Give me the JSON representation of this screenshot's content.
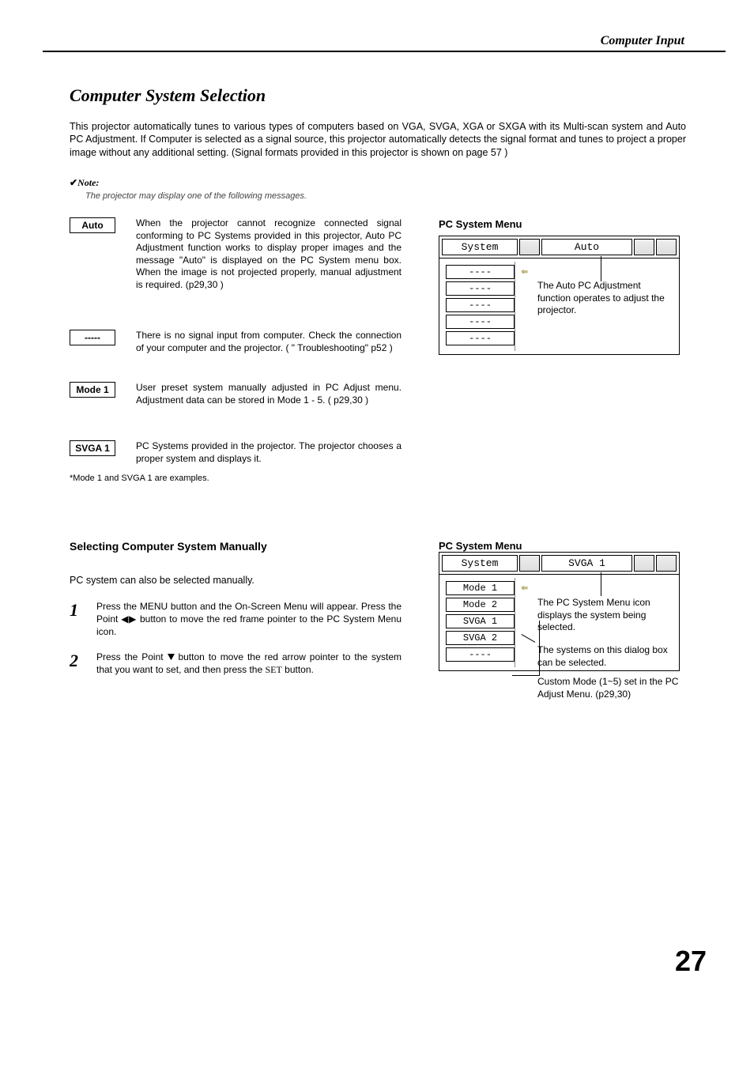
{
  "header": {
    "section": "Computer Input"
  },
  "title": "Computer System Selection",
  "intro": "This projector automatically tunes to various types of computers based on VGA, SVGA, XGA or SXGA with its Multi-scan system and Auto PC Adjustment.  If Computer is selected as a signal source, this projector automatically detects the signal format and tunes to project a proper image without any additional setting.  (Signal formats provided in this projector is shown on page 57 )",
  "note": {
    "label": "Note:",
    "text": "The projector may display one of the following messages."
  },
  "boxes": {
    "auto": {
      "label": "Auto",
      "text": "When the projector cannot recognize connected signal conforming to PC Systems provided in this projector, Auto PC Adjustment function works to display proper images and the message \"Auto\" is displayed on the PC System menu box.  When the image is not projected properly, manual adjustment is required.  (p29,30 )"
    },
    "dash": {
      "label": "-----",
      "text": "There is no signal input from computer.  Check the connection of your computer and the projector.   ( \" Troubleshooting\" p52 )"
    },
    "mode1": {
      "label": "Mode 1",
      "text": "User preset system manually adjusted in PC Adjust menu.  Adjustment data can be stored in Mode 1 - 5. ( p29,30 )"
    },
    "svga1": {
      "label": "SVGA 1",
      "text": "PC Systems provided in the projector.  The projector chooses a proper system and displays it."
    }
  },
  "footnote": "*Mode 1 and SVGA 1 are examples.",
  "sub": {
    "title": "Selecting Computer System Manually",
    "intro": "PC system can also be selected manually.",
    "step1": "Press the MENU button and the On-Screen Menu will appear.  Press the Point ◀▶ button to move the red frame pointer to the PC System Menu icon.",
    "step2a": "Press the Point ",
    "step2b": " button to move the red arrow pointer to the system that you want to set, and then press the ",
    "step2c": " button.",
    "set": "SET"
  },
  "menu": {
    "labelA": "PC System Menu",
    "labelB": "PC System Menu",
    "system": "System",
    "autoVal": "Auto",
    "svgaVal": "SVGA 1",
    "blank": "----",
    "itemsB": [
      "Mode 1",
      "Mode 2",
      "SVGA 1",
      "SVGA 2",
      "----"
    ]
  },
  "annot": {
    "a1": "The Auto PC Adjustment function operates to adjust the projector.",
    "b1": "The PC System Menu icon displays the system being selected.",
    "b2": "The systems on this dialog box can be selected.",
    "b3": "Custom Mode (1~5) set in the PC Adjust Menu.  (p29,30)"
  },
  "page": "27"
}
